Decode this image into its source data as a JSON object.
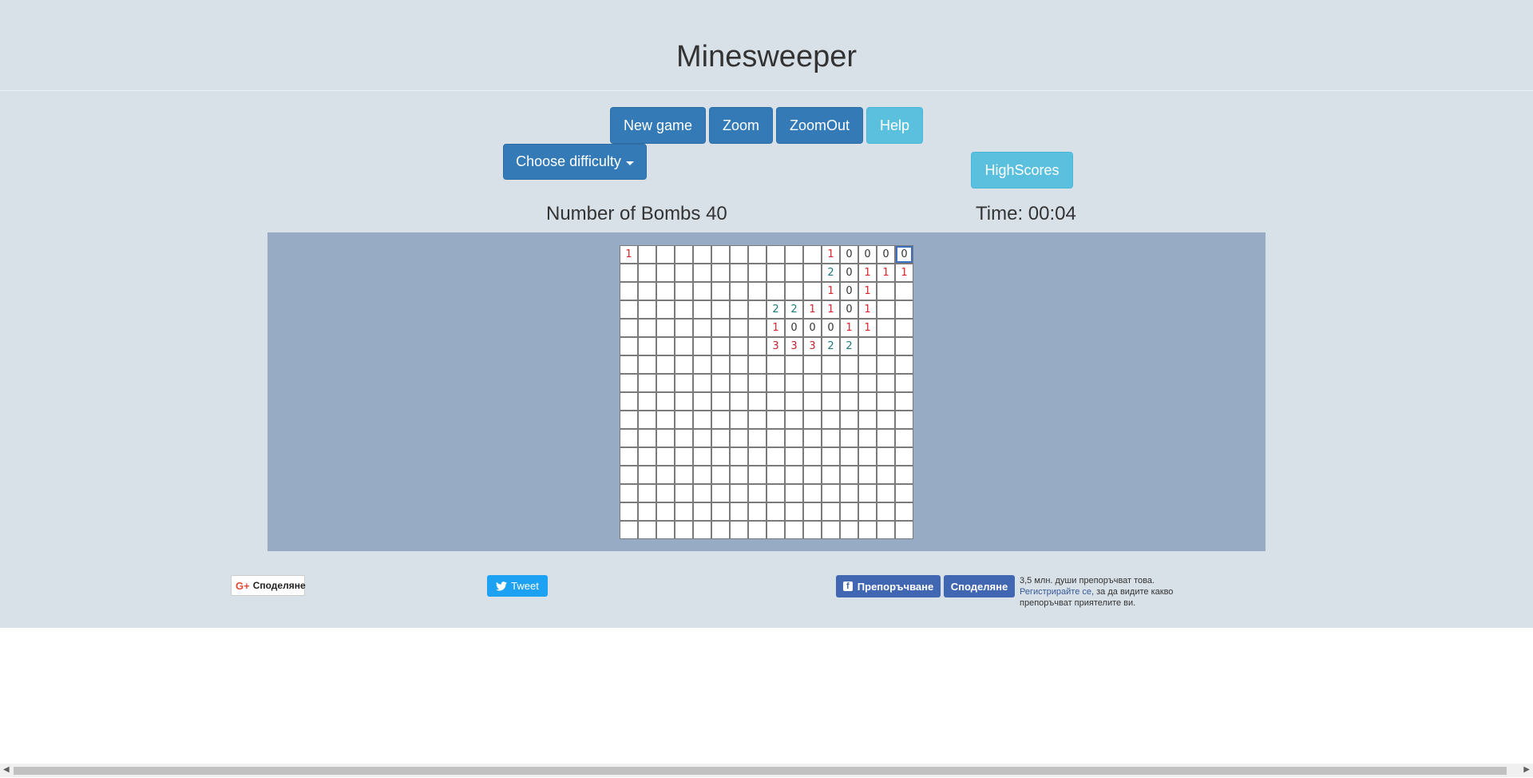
{
  "title": "Minesweeper",
  "toolbar": {
    "new_game": "New game",
    "zoom": "Zoom",
    "zoom_out": "ZoomOut",
    "help": "Help",
    "difficulty": "Choose difficulty",
    "highscores": "HighScores"
  },
  "status": {
    "bombs": "Number of Bombs 40",
    "time": "Time: 00:04"
  },
  "board": {
    "rows": 16,
    "cols": 16,
    "cells": [
      [
        "1",
        "",
        "",
        "",
        "",
        "",
        "",
        "",
        "",
        "",
        "",
        "1",
        "0",
        "0",
        "0",
        "0"
      ],
      [
        "",
        "",
        "",
        "",
        "",
        "",
        "",
        "",
        "",
        "",
        "",
        "2",
        "0",
        "1",
        "1",
        "1"
      ],
      [
        "",
        "",
        "",
        "",
        "",
        "",
        "",
        "",
        "",
        "",
        "",
        "1",
        "0",
        "1",
        "",
        ""
      ],
      [
        "",
        "",
        "",
        "",
        "",
        "",
        "",
        "",
        "2",
        "2",
        "1",
        "1",
        "0",
        "1",
        "",
        ""
      ],
      [
        "",
        "",
        "",
        "",
        "",
        "",
        "",
        "",
        "1",
        "0",
        "0",
        "0",
        "1",
        "1",
        "",
        ""
      ],
      [
        "",
        "",
        "",
        "",
        "",
        "",
        "",
        "",
        "3",
        "3",
        "3",
        "2",
        "2",
        "",
        "",
        ""
      ],
      [
        "",
        "",
        "",
        "",
        "",
        "",
        "",
        "",
        "",
        "",
        "",
        "",
        "",
        "",
        "",
        ""
      ],
      [
        "",
        "",
        "",
        "",
        "",
        "",
        "",
        "",
        "",
        "",
        "",
        "",
        "",
        "",
        "",
        ""
      ],
      [
        "",
        "",
        "",
        "",
        "",
        "",
        "",
        "",
        "",
        "",
        "",
        "",
        "",
        "",
        "",
        ""
      ],
      [
        "",
        "",
        "",
        "",
        "",
        "",
        "",
        "",
        "",
        "",
        "",
        "",
        "",
        "",
        "",
        ""
      ],
      [
        "",
        "",
        "",
        "",
        "",
        "",
        "",
        "",
        "",
        "",
        "",
        "",
        "",
        "",
        "",
        ""
      ],
      [
        "",
        "",
        "",
        "",
        "",
        "",
        "",
        "",
        "",
        "",
        "",
        "",
        "",
        "",
        "",
        ""
      ],
      [
        "",
        "",
        "",
        "",
        "",
        "",
        "",
        "",
        "",
        "",
        "",
        "",
        "",
        "",
        "",
        ""
      ],
      [
        "",
        "",
        "",
        "",
        "",
        "",
        "",
        "",
        "",
        "",
        "",
        "",
        "",
        "",
        "",
        ""
      ],
      [
        "",
        "",
        "",
        "",
        "",
        "",
        "",
        "",
        "",
        "",
        "",
        "",
        "",
        "",
        "",
        ""
      ],
      [
        "",
        "",
        "",
        "",
        "",
        "",
        "",
        "",
        "",
        "",
        "",
        "",
        "",
        "",
        "",
        ""
      ]
    ],
    "focused_cell": [
      0,
      15
    ]
  },
  "social": {
    "gplus_share": "Споделяне",
    "tweet": "Tweet",
    "fb_like": "Препоръчване",
    "fb_share": "Споделяне",
    "fb_count_text": "3,5 млн. души препоръчват това.",
    "fb_register_link": "Регистрирайте се,",
    "fb_register_rest": " за да видите какво препоръчват приятелите ви."
  },
  "colors": {
    "page_bg": "#d9e1e8",
    "board_bg": "#97abc5",
    "primary": "#337ab7",
    "info": "#5bc0de",
    "number_1": "#d9262c",
    "number_2": "#1f7a7a",
    "number_3": "#c0262c"
  }
}
